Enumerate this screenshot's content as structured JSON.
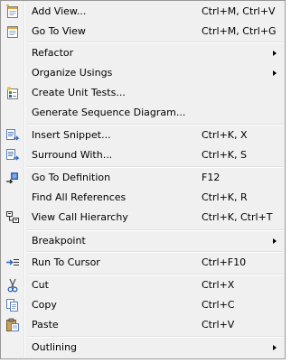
{
  "context_menu": {
    "items": {
      "add_view": {
        "label": "Add View...",
        "shortcut": "Ctrl+M, Ctrl+V",
        "icon": "add-view-icon"
      },
      "go_to_view": {
        "label": "Go To View",
        "shortcut": "Ctrl+M, Ctrl+G",
        "icon": "go-to-view-icon"
      },
      "refactor": {
        "label": "Refactor",
        "submenu": true
      },
      "organize_usings": {
        "label": "Organize Usings",
        "submenu": true
      },
      "create_unit_tests": {
        "label": "Create Unit Tests...",
        "icon": "unit-test-icon"
      },
      "generate_sequence_diagram": {
        "label": "Generate Sequence Diagram..."
      },
      "insert_snippet": {
        "label": "Insert Snippet...",
        "shortcut": "Ctrl+K, X",
        "icon": "insert-snippet-icon"
      },
      "surround_with": {
        "label": "Surround With...",
        "shortcut": "Ctrl+K, S",
        "icon": "surround-with-icon"
      },
      "go_to_definition": {
        "label": "Go To Definition",
        "shortcut": "F12",
        "icon": "go-to-definition-icon"
      },
      "find_all_references": {
        "label": "Find All References",
        "shortcut": "Ctrl+K, R"
      },
      "view_call_hierarchy": {
        "label": "View Call Hierarchy",
        "shortcut": "Ctrl+K, Ctrl+T",
        "icon": "call-hierarchy-icon"
      },
      "breakpoint": {
        "label": "Breakpoint",
        "submenu": true
      },
      "run_to_cursor": {
        "label": "Run To Cursor",
        "shortcut": "Ctrl+F10",
        "icon": "run-to-cursor-icon"
      },
      "cut": {
        "label": "Cut",
        "shortcut": "Ctrl+X",
        "icon": "scissors-icon"
      },
      "copy": {
        "label": "Copy",
        "shortcut": "Ctrl+C",
        "icon": "copy-icon"
      },
      "paste": {
        "label": "Paste",
        "shortcut": "Ctrl+V",
        "icon": "paste-icon"
      },
      "outlining": {
        "label": "Outlining",
        "submenu": true
      }
    }
  },
  "colors": {
    "menu_background": "#f0f0f0",
    "menu_border": "#979797",
    "separator": "#e0e0e0",
    "icon_blue": "#2f63b5"
  }
}
